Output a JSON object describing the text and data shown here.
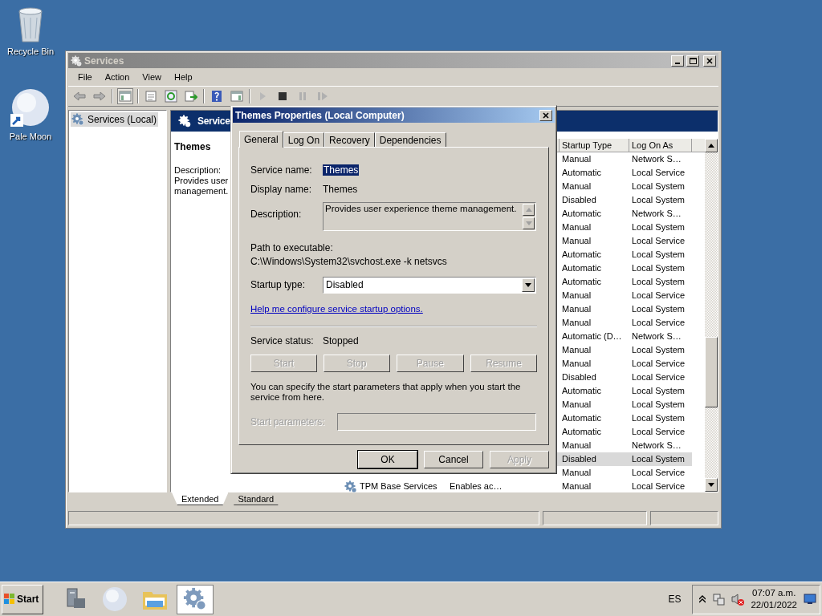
{
  "desktop_icons": [
    {
      "label": "Recycle Bin",
      "kind": "bin"
    },
    {
      "label": "Pale Moon",
      "kind": "globe"
    }
  ],
  "services_window": {
    "title": "Services",
    "menu": [
      "File",
      "Action",
      "View",
      "Help"
    ],
    "tree": [
      {
        "label": "Services (Local)",
        "selected": true
      }
    ],
    "header": "Service",
    "detail": {
      "name": "Themes",
      "description_label": "Description:",
      "description_lines": [
        "Provides user",
        "management."
      ]
    },
    "list": {
      "columns": [
        "Startup Type",
        "Log On As"
      ],
      "rows": [
        {
          "startup": "Manual",
          "logon": "Network S…",
          "selected": false
        },
        {
          "startup": "Automatic",
          "logon": "Local Service",
          "selected": false
        },
        {
          "startup": "Manual",
          "logon": "Local System",
          "selected": false
        },
        {
          "startup": "Disabled",
          "logon": "Local System",
          "selected": false
        },
        {
          "startup": "Automatic",
          "logon": "Network S…",
          "selected": false
        },
        {
          "startup": "Manual",
          "logon": "Local System",
          "selected": false
        },
        {
          "startup": "Manual",
          "logon": "Local Service",
          "selected": false
        },
        {
          "startup": "Automatic",
          "logon": "Local System",
          "selected": false
        },
        {
          "startup": "Automatic",
          "logon": "Local System",
          "selected": false
        },
        {
          "startup": "Automatic",
          "logon": "Local System",
          "selected": false
        },
        {
          "startup": "Manual",
          "logon": "Local Service",
          "selected": false
        },
        {
          "startup": "Manual",
          "logon": "Local System",
          "selected": false
        },
        {
          "startup": "Manual",
          "logon": "Local Service",
          "selected": false
        },
        {
          "startup": "Automatic (D…",
          "logon": "Network S…",
          "selected": false
        },
        {
          "startup": "Manual",
          "logon": "Local System",
          "selected": false
        },
        {
          "startup": "Manual",
          "logon": "Local Service",
          "selected": false
        },
        {
          "startup": "Disabled",
          "logon": "Local Service",
          "selected": false
        },
        {
          "startup": "Automatic",
          "logon": "Local System",
          "selected": false
        },
        {
          "startup": "Manual",
          "logon": "Local System",
          "selected": false
        },
        {
          "startup": "Automatic",
          "logon": "Local System",
          "selected": false
        },
        {
          "startup": "Automatic",
          "logon": "Local Service",
          "selected": false
        },
        {
          "startup": "Manual",
          "logon": "Network S…",
          "selected": false
        },
        {
          "startup": "Disabled",
          "logon": "Local System",
          "selected": true
        },
        {
          "startup": "Manual",
          "logon": "Local Service",
          "selected": false
        },
        {
          "name": "TPM Base Services",
          "description": "Enables ac…",
          "startup": "Manual",
          "logon": "Local Service",
          "selected": false
        }
      ]
    },
    "view_tabs": [
      {
        "label": "Extended",
        "selected": true
      },
      {
        "label": "Standard",
        "selected": false
      }
    ]
  },
  "dialog": {
    "title": "Themes Properties (Local Computer)",
    "tabs": [
      {
        "label": "General",
        "selected": true
      },
      {
        "label": "Log On",
        "selected": false
      },
      {
        "label": "Recovery",
        "selected": false
      },
      {
        "label": "Dependencies",
        "selected": false
      }
    ],
    "service_name_label": "Service name:",
    "service_name": "Themes",
    "display_name_label": "Display name:",
    "display_name": "Themes",
    "description_label": "Description:",
    "description": "Provides user experience theme management.",
    "path_label": "Path to executable:",
    "path": "C:\\Windows\\System32\\svchost.exe -k netsvcs",
    "startup_type_label": "Startup type:",
    "startup_type": "Disabled",
    "help_link": "Help me configure service startup options.",
    "status_label": "Service status:",
    "status": "Stopped",
    "service_buttons": [
      {
        "label": "Start",
        "disabled": true
      },
      {
        "label": "Stop",
        "disabled": true
      },
      {
        "label": "Pause",
        "disabled": true
      },
      {
        "label": "Resume",
        "disabled": true
      }
    ],
    "params_note": "You can specify the start parameters that apply when you start the service from here.",
    "start_parameters": {
      "label": "Start parameters:",
      "disabled": true
    },
    "buttons": [
      {
        "label": "OK",
        "disabled": false,
        "default": true
      },
      {
        "label": "Cancel",
        "disabled": false,
        "default": false
      },
      {
        "label": "Apply",
        "disabled": true,
        "default": false
      }
    ]
  },
  "taskbar": {
    "start": "Start",
    "language": "ES",
    "time": "07:07 a.m.",
    "date": "22/01/2022"
  }
}
